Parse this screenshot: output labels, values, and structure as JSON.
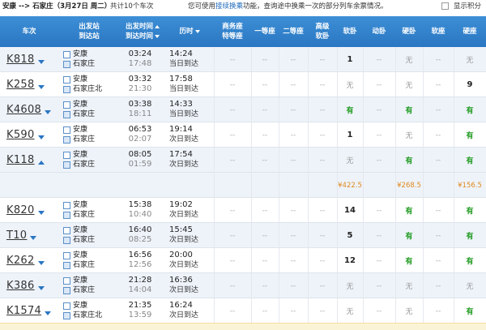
{
  "topbar": {
    "route": "安康 --> 石家庄",
    "date": "（3月27日 周二）",
    "count": "共计10个车次",
    "hint_pre": "您可使用",
    "hint_link": "接续换乘",
    "hint_post": "功能，查询途中换乘一次的部分列车余票情况。",
    "show_points": "显示积分"
  },
  "headers": {
    "train": "车次",
    "station_1": "出发站",
    "station_2": "到达站",
    "time_1": "出发时间",
    "time_2": "到达时间",
    "duration": "历时",
    "business_1": "商务座",
    "business_2": "特等座",
    "first": "一等座",
    "second": "二等座",
    "adv_soft_1": "高级",
    "adv_soft_2": "软卧",
    "soft_sleeper": "软卧",
    "dongwo": "动卧",
    "hard_sleeper": "硬卧",
    "soft_seat": "软座",
    "hard_seat": "硬座"
  },
  "trains": [
    {
      "code": "K818",
      "from": "安康",
      "to": "石家庄",
      "dep": "03:24",
      "arr": "17:48",
      "dur": "14:24",
      "day": "当日到达",
      "seats": [
        "--",
        "--",
        "--",
        "--",
        "1",
        "--",
        "无",
        "--",
        "无"
      ]
    },
    {
      "code": "K258",
      "from": "安康",
      "to": "石家庄北",
      "dep": "03:32",
      "arr": "21:30",
      "dur": "17:58",
      "day": "当日到达",
      "seats": [
        "--",
        "--",
        "--",
        "--",
        "无",
        "--",
        "无",
        "--",
        "9"
      ]
    },
    {
      "code": "K4608",
      "from": "安康",
      "to": "石家庄",
      "dep": "03:38",
      "arr": "18:11",
      "dur": "14:33",
      "day": "当日到达",
      "seats": [
        "--",
        "--",
        "--",
        "--",
        "有",
        "--",
        "有",
        "--",
        "有"
      ]
    },
    {
      "code": "K590",
      "from": "安康",
      "to": "石家庄",
      "dep": "06:53",
      "arr": "02:07",
      "dur": "19:14",
      "day": "次日到达",
      "seats": [
        "--",
        "--",
        "--",
        "--",
        "1",
        "--",
        "无",
        "--",
        "有"
      ]
    },
    {
      "code": "K118",
      "from": "安康",
      "to": "石家庄",
      "dep": "08:05",
      "arr": "01:59",
      "dur": "17:54",
      "day": "次日到达",
      "seats": [
        "--",
        "--",
        "--",
        "--",
        "无",
        "--",
        "有",
        "--",
        "有"
      ]
    },
    {
      "code": "K820",
      "from": "安康",
      "to": "石家庄",
      "dep": "15:38",
      "arr": "10:40",
      "dur": "19:02",
      "day": "次日到达",
      "seats": [
        "--",
        "--",
        "--",
        "--",
        "14",
        "--",
        "有",
        "--",
        "有"
      ]
    },
    {
      "code": "T10",
      "from": "安康",
      "to": "石家庄",
      "dep": "16:40",
      "arr": "08:25",
      "dur": "15:45",
      "day": "次日到达",
      "seats": [
        "--",
        "--",
        "--",
        "--",
        "5",
        "--",
        "有",
        "--",
        "有"
      ]
    },
    {
      "code": "K262",
      "from": "安康",
      "to": "石家庄",
      "dep": "16:56",
      "arr": "12:56",
      "dur": "20:00",
      "day": "次日到达",
      "seats": [
        "--",
        "--",
        "--",
        "--",
        "12",
        "--",
        "有",
        "--",
        "有"
      ]
    },
    {
      "code": "K386",
      "from": "安康",
      "to": "石家庄",
      "dep": "21:28",
      "arr": "14:04",
      "dur": "16:36",
      "day": "次日到达",
      "seats": [
        "--",
        "--",
        "--",
        "--",
        "无",
        "--",
        "无",
        "--",
        "无"
      ]
    },
    {
      "code": "K1574",
      "from": "安康",
      "to": "石家庄北",
      "dep": "21:35",
      "arr": "13:59",
      "dur": "16:24",
      "day": "次日到达",
      "seats": [
        "--",
        "--",
        "--",
        "--",
        "无",
        "--",
        "无",
        "--",
        "有"
      ]
    }
  ],
  "prices": {
    "soft_sleeper": "¥422.5",
    "hard_sleeper": "¥268.5",
    "hard_seat": "¥156.5"
  },
  "colors": {
    "header": "#2a76c2",
    "available": "#1d9a1d",
    "price": "#e08a1e",
    "alt_row": "#eef3fa"
  }
}
